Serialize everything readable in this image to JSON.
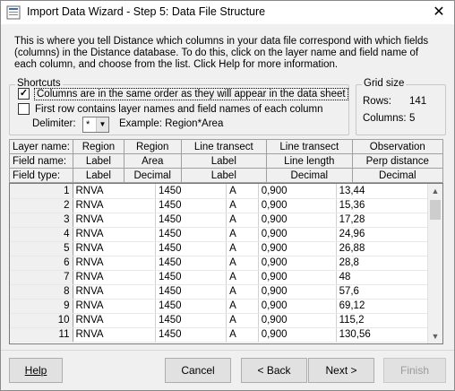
{
  "window": {
    "title": "Import Data Wizard - Step 5: Data File Structure"
  },
  "intro_text": "This is where you tell Distance which columns in your data file correspond with which fields (columns) in the Distance database. To do this, click on the layer name and field name of each column, and choose from the list.  Click Help for more information.",
  "shortcuts": {
    "label": "Shortcuts",
    "same_order": {
      "label": "Columns are in the same order as they will appear in the data sheet",
      "checked": true
    },
    "first_row_names": {
      "label": "First row contains layer names and field names of each column",
      "checked": false
    },
    "delimiter_label": "Delimiter:",
    "delimiter_value": "*",
    "example_text": "Example: Region*Area"
  },
  "grid_size": {
    "label": "Grid size",
    "rows_label": "Rows:",
    "rows_value": "141",
    "columns_label": "Columns:",
    "columns_value": "5"
  },
  "header_rows": [
    {
      "label": "Layer name:",
      "cells": [
        "Region",
        "Region",
        "Line transect",
        "Line transect",
        "Observation"
      ]
    },
    {
      "label": "Field name:",
      "cells": [
        "Label",
        "Area",
        "Label",
        "Line length",
        "Perp distance"
      ]
    },
    {
      "label": "Field type:",
      "cells": [
        "Label",
        "Decimal",
        "Label",
        "Decimal",
        "Decimal"
      ]
    }
  ],
  "data_rows": [
    {
      "n": "1",
      "cells": [
        "RNVA",
        "1450",
        "A",
        "0,900",
        "13,44"
      ]
    },
    {
      "n": "2",
      "cells": [
        "RNVA",
        "1450",
        "A",
        "0,900",
        "15,36"
      ]
    },
    {
      "n": "3",
      "cells": [
        "RNVA",
        "1450",
        "A",
        "0,900",
        "17,28"
      ]
    },
    {
      "n": "4",
      "cells": [
        "RNVA",
        "1450",
        "A",
        "0,900",
        "24,96"
      ]
    },
    {
      "n": "5",
      "cells": [
        "RNVA",
        "1450",
        "A",
        "0,900",
        "26,88"
      ]
    },
    {
      "n": "6",
      "cells": [
        "RNVA",
        "1450",
        "A",
        "0,900",
        "28,8"
      ]
    },
    {
      "n": "7",
      "cells": [
        "RNVA",
        "1450",
        "A",
        "0,900",
        "48"
      ]
    },
    {
      "n": "8",
      "cells": [
        "RNVA",
        "1450",
        "A",
        "0,900",
        "57,6"
      ]
    },
    {
      "n": "9",
      "cells": [
        "RNVA",
        "1450",
        "A",
        "0,900",
        "69,12"
      ]
    },
    {
      "n": "10",
      "cells": [
        "RNVA",
        "1450",
        "A",
        "0,900",
        "115,2"
      ]
    },
    {
      "n": "11",
      "cells": [
        "RNVA",
        "1450",
        "A",
        "0,900",
        "130,56"
      ]
    }
  ],
  "buttons": {
    "help": "Help",
    "cancel": "Cancel",
    "back": "< Back",
    "next": "Next >",
    "finish": "Finish"
  },
  "icons": {
    "app": "wizard-app-icon",
    "close": "close-icon",
    "scroll_up": "chevron-up-icon",
    "scroll_down": "chevron-down-icon",
    "dropdown": "chevron-down-icon"
  }
}
